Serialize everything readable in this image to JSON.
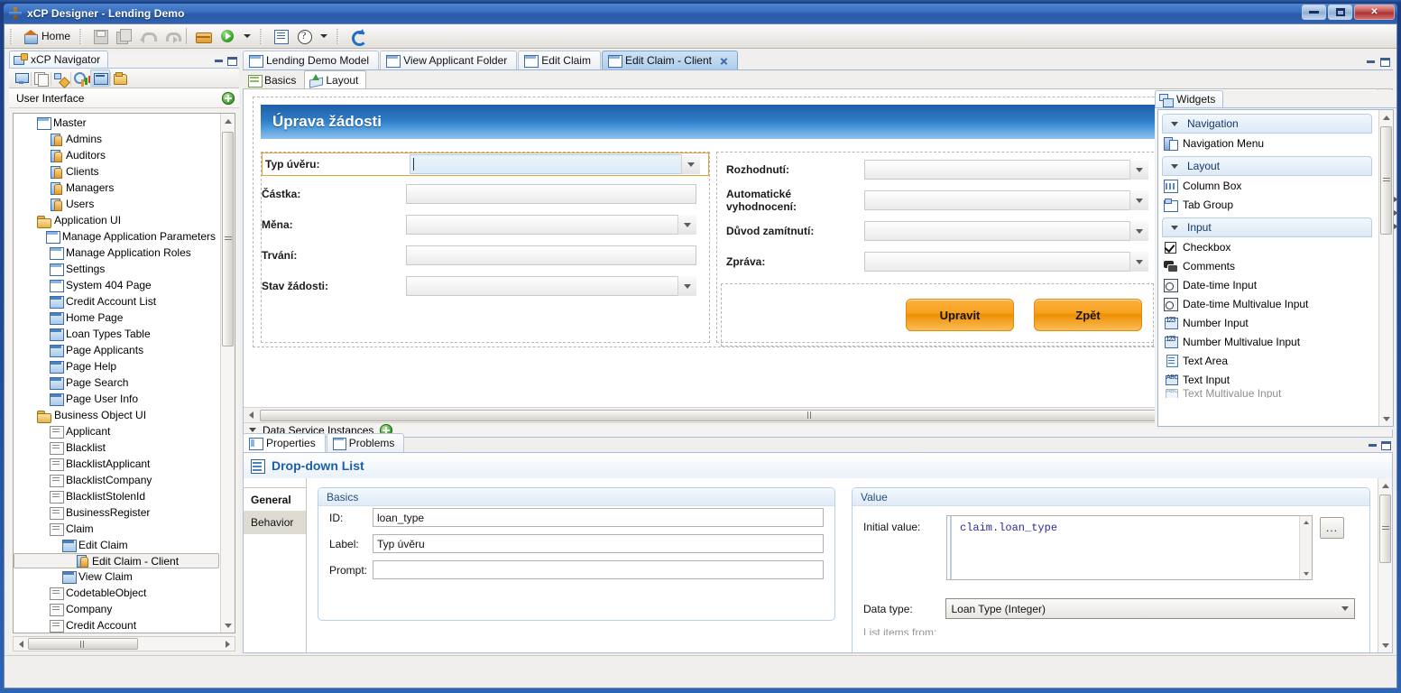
{
  "window": {
    "title": "xCP Designer - Lending Demo",
    "app_icon": "xcp-logo-icon",
    "minimize": "–",
    "maximize": "□",
    "close": "✕"
  },
  "toolbar": {
    "home_label": "Home",
    "items": [
      {
        "name": "home",
        "label": "Home",
        "icon": "home-icon"
      },
      {
        "name": "save",
        "label": "",
        "icon": "save-icon"
      },
      {
        "name": "save-all",
        "label": "",
        "icon": "save-all-icon"
      },
      {
        "name": "undo",
        "label": "",
        "icon": "undo-icon"
      },
      {
        "name": "redo",
        "label": "",
        "icon": "redo-icon"
      },
      {
        "name": "deploy",
        "label": "",
        "icon": "deploy-icon"
      },
      {
        "name": "run",
        "label": "",
        "icon": "run-icon"
      },
      {
        "name": "tasks",
        "label": "",
        "icon": "tasks-icon"
      },
      {
        "name": "help",
        "label": "",
        "icon": "help-icon"
      },
      {
        "name": "refresh",
        "label": "",
        "icon": "refresh-icon"
      }
    ]
  },
  "navigator": {
    "tab_label": "xCP Navigator",
    "tab_icon": "navigator-icon",
    "minimize": "minimize-icon",
    "maximize": "maximize-icon",
    "toolbar_icons": [
      "model-icon",
      "copy-icon",
      "process-icon",
      "report-icon",
      "page-icon",
      "folder-open-icon"
    ],
    "section_title": "User Interface",
    "add_icon": "add-green-icon",
    "tree": [
      {
        "label": "Master",
        "indent": 1,
        "icon": "page-icon"
      },
      {
        "label": "Admins",
        "indent": 2,
        "icon": "role-icon"
      },
      {
        "label": "Auditors",
        "indent": 2,
        "icon": "role-icon"
      },
      {
        "label": "Clients",
        "indent": 2,
        "icon": "role-icon"
      },
      {
        "label": "Managers",
        "indent": 2,
        "icon": "role-icon"
      },
      {
        "label": "Users",
        "indent": 2,
        "icon": "role-icon"
      },
      {
        "label": "Application UI",
        "indent": 1,
        "icon": "folder-icon"
      },
      {
        "label": "Manage Application Parameters",
        "indent": 2,
        "icon": "page-icon"
      },
      {
        "label": "Manage Application Roles",
        "indent": 2,
        "icon": "page-icon"
      },
      {
        "label": "Settings",
        "indent": 2,
        "icon": "page-icon"
      },
      {
        "label": "System 404 Page",
        "indent": 2,
        "icon": "page-icon"
      },
      {
        "label": "Credit Account List",
        "indent": 2,
        "icon": "page-full-icon"
      },
      {
        "label": "Home Page",
        "indent": 2,
        "icon": "page-full-icon"
      },
      {
        "label": "Loan Types Table",
        "indent": 2,
        "icon": "page-full-icon"
      },
      {
        "label": "Page Applicants",
        "indent": 2,
        "icon": "page-full-icon"
      },
      {
        "label": "Page Help",
        "indent": 2,
        "icon": "page-full-icon"
      },
      {
        "label": "Page Search",
        "indent": 2,
        "icon": "page-full-icon"
      },
      {
        "label": "Page User Info",
        "indent": 2,
        "icon": "page-full-icon"
      },
      {
        "label": "Business Object UI",
        "indent": 1,
        "icon": "folder-icon"
      },
      {
        "label": "Applicant",
        "indent": 2,
        "icon": "business-object-icon"
      },
      {
        "label": "Blacklist",
        "indent": 2,
        "icon": "business-object-icon"
      },
      {
        "label": "BlacklistApplicant",
        "indent": 2,
        "icon": "business-object-icon"
      },
      {
        "label": "BlacklistCompany",
        "indent": 2,
        "icon": "business-object-icon"
      },
      {
        "label": "BlacklistStolenId",
        "indent": 2,
        "icon": "business-object-icon"
      },
      {
        "label": "BusinessRegister",
        "indent": 2,
        "icon": "business-object-icon"
      },
      {
        "label": "Claim",
        "indent": 2,
        "icon": "business-object-icon"
      },
      {
        "label": "Edit Claim",
        "indent": 3,
        "icon": "page-full-icon"
      },
      {
        "label": "Edit Claim - Client",
        "indent": 4,
        "icon": "role-icon",
        "selected": true
      },
      {
        "label": "View Claim",
        "indent": 3,
        "icon": "page-full-icon"
      },
      {
        "label": "CodetableObject",
        "indent": 2,
        "icon": "business-object-icon"
      },
      {
        "label": "Company",
        "indent": 2,
        "icon": "business-object-icon"
      },
      {
        "label": "Credit Account",
        "indent": 2,
        "icon": "business-object-icon"
      }
    ]
  },
  "editor": {
    "tabs": [
      {
        "label": "Lending Demo Model",
        "icon": "page-icon",
        "active": false,
        "closable": false
      },
      {
        "label": "View Applicant Folder",
        "icon": "page-icon",
        "active": false,
        "closable": false
      },
      {
        "label": "Edit Claim",
        "icon": "page-icon",
        "active": false,
        "closable": false
      },
      {
        "label": "Edit Claim - Client",
        "icon": "page-icon",
        "active": true,
        "closable": true
      }
    ],
    "inner_tabs": [
      {
        "label": "Basics",
        "icon": "basics-icon",
        "active": false
      },
      {
        "label": "Layout",
        "icon": "layout-icon",
        "active": true
      }
    ],
    "form": {
      "banner_title": "Úprava žádosti",
      "left_fields": [
        {
          "label": "Typ úvěru:",
          "type": "dropdown",
          "value": "",
          "focused": true
        },
        {
          "label": "Částka:",
          "type": "text",
          "value": ""
        },
        {
          "label": "Měna:",
          "type": "dropdown",
          "value": ""
        },
        {
          "label": "Trvání:",
          "type": "text",
          "value": ""
        },
        {
          "label": "Stav žádosti:",
          "type": "dropdown",
          "value": ""
        }
      ],
      "right_fields": [
        {
          "label": "Rozhodnutí:",
          "type": "dropdown",
          "value": ""
        },
        {
          "label": "Automatické vyhodnocení:",
          "type": "dropdown",
          "value": ""
        },
        {
          "label": "Důvod zamítnutí:",
          "type": "dropdown",
          "value": ""
        },
        {
          "label": "Zpráva:",
          "type": "dropdown",
          "value": ""
        }
      ],
      "buttons": [
        {
          "label": "Upravit"
        },
        {
          "label": "Zpět"
        }
      ]
    },
    "data_service_instances": {
      "label": "Data Service Instances",
      "add_icon": "add-green-icon",
      "collapse_icon": "triangle-down-icon"
    }
  },
  "palette": {
    "tab_label": "Widgets",
    "tab_icon": "widgets-icon",
    "groups": [
      {
        "label": "Navigation",
        "items": [
          {
            "label": "Navigation Menu",
            "icon": "navigation-menu-icon"
          }
        ]
      },
      {
        "label": "Layout",
        "items": [
          {
            "label": "Column Box",
            "icon": "column-box-icon"
          },
          {
            "label": "Tab Group",
            "icon": "tab-group-icon"
          }
        ]
      },
      {
        "label": "Input",
        "items": [
          {
            "label": "Checkbox",
            "icon": "checkbox-icon"
          },
          {
            "label": "Comments",
            "icon": "comments-icon"
          },
          {
            "label": "Date-time Input",
            "icon": "date-time-icon"
          },
          {
            "label": "Date-time Multivalue Input",
            "icon": "date-time-icon"
          },
          {
            "label": "Number Input",
            "icon": "number-icon"
          },
          {
            "label": "Number Multivalue Input",
            "icon": "number-icon"
          },
          {
            "label": "Text Area",
            "icon": "text-area-icon"
          },
          {
            "label": "Text Input",
            "icon": "text-input-icon"
          }
        ]
      }
    ]
  },
  "properties": {
    "tabs": [
      {
        "label": "Properties",
        "icon": "properties-icon",
        "active": true
      },
      {
        "label": "Problems",
        "icon": "problems-icon",
        "active": false
      }
    ],
    "title": "Drop-down List",
    "title_icon": "dropdown-list-icon",
    "side_tabs": [
      {
        "label": "General",
        "active": true
      },
      {
        "label": "Behavior",
        "active": false
      }
    ],
    "basics": {
      "group_title": "Basics",
      "fields": [
        {
          "label": "ID:",
          "value": "loan_type",
          "placeholder": ""
        },
        {
          "label": "Label:",
          "value": "Typ úvěru",
          "placeholder": ""
        },
        {
          "label": "Prompt:",
          "value": "",
          "placeholder": ""
        }
      ]
    },
    "value": {
      "group_title": "Value",
      "initial_value_label": "Initial value:",
      "initial_value": "claim.loan_type",
      "browse_button": "...",
      "data_type_label": "Data type:",
      "data_type_value": "Loan Type (Integer)",
      "clipped_label": "List items from:"
    }
  },
  "colors": {
    "title_bar": "#2a5aa8",
    "banner_blue": "#2f7bc4",
    "accent_orange": "#f8a21f",
    "focus_orange": "#e2a13a",
    "link_blue": "#1b5fa8",
    "code_blue": "#2b2b9b"
  }
}
